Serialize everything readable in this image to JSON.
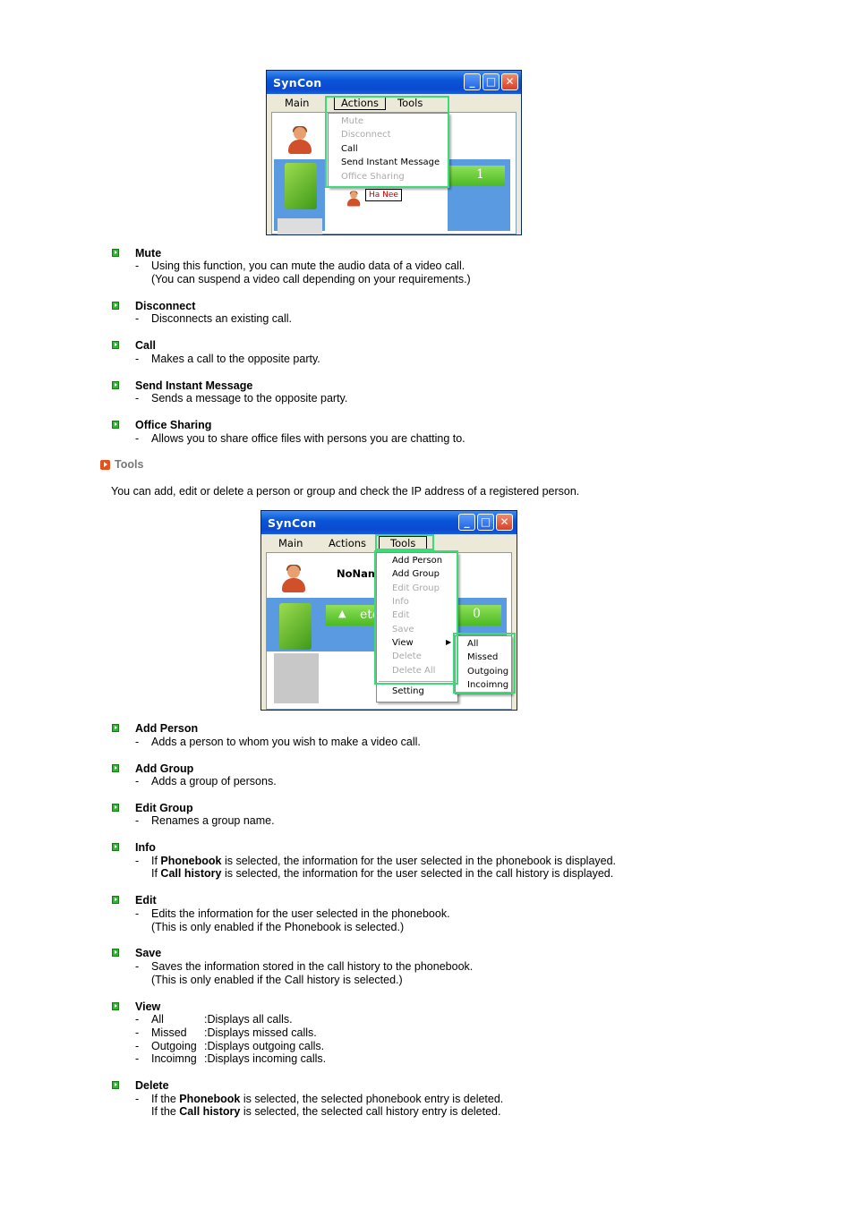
{
  "window1": {
    "title": "SynCon",
    "menu": [
      "Main",
      "Actions",
      "Tools"
    ],
    "actions_menu": [
      {
        "label": "Mute",
        "enabled": false
      },
      {
        "label": "Disconnect",
        "enabled": false
      },
      {
        "label": "Call",
        "enabled": true
      },
      {
        "label": "Send Instant Message",
        "enabled": true
      },
      {
        "label": "Office Sharing",
        "enabled": false
      }
    ],
    "count": "1",
    "contact": "Ha Nee"
  },
  "section1_items": [
    {
      "title": "Mute",
      "lines": [
        "Using this function, you can mute the audio data of a video call.",
        "(You can suspend a video call depending on your requirements.)"
      ]
    },
    {
      "title": "Disconnect",
      "lines": [
        "Disconnects an existing call."
      ]
    },
    {
      "title": "Call",
      "lines": [
        "Makes a call to the opposite party."
      ]
    },
    {
      "title": "Send Instant Message",
      "lines": [
        "Sends a message to the opposite party."
      ]
    },
    {
      "title": "Office Sharing",
      "lines": [
        "Allows you to share office files with persons you are chatting to."
      ]
    }
  ],
  "tools_heading": "Tools",
  "tools_intro": "You can add, edit or delete a person or group and check the IP address of a registered person.",
  "window2": {
    "title": "SynCon",
    "menu": [
      "Main",
      "Actions",
      "Tools"
    ],
    "user": "NoNam",
    "group_label": "etc",
    "count": "0",
    "tools_menu": [
      {
        "label": "Add Person",
        "enabled": true
      },
      {
        "label": "Add Group",
        "enabled": true
      },
      {
        "label": "Edit Group",
        "enabled": false
      },
      {
        "label": "Info",
        "enabled": false
      },
      {
        "label": "Edit",
        "enabled": false
      },
      {
        "label": "Save",
        "enabled": false
      },
      {
        "label": "View",
        "enabled": true
      },
      {
        "label": "Delete",
        "enabled": false
      },
      {
        "label": "Delete All",
        "enabled": false
      },
      {
        "label": "Setting",
        "enabled": true
      }
    ],
    "view_submenu": [
      "All",
      "Missed",
      "Outgoing",
      "Incoimng"
    ]
  },
  "section2": {
    "add_person": {
      "title": "Add Person",
      "line": "Adds a person to whom you wish to make a video call."
    },
    "add_group": {
      "title": "Add Group",
      "line": "Adds a group of persons."
    },
    "edit_group": {
      "title": "Edit Group",
      "line": "Renames a group name."
    },
    "info": {
      "title": "Info",
      "line1_pre": "If ",
      "line1_bold": "Phonebook",
      "line1_post": " is selected, the information for the user selected in the phonebook is displayed.",
      "line2_pre": "If ",
      "line2_bold": "Call history",
      "line2_post": " is selected, the information for the user selected in the call history is displayed."
    },
    "edit": {
      "title": "Edit",
      "line1": "Edits the information for the user selected in the phonebook.",
      "line2": "(This is only enabled if the Phonebook is selected.)"
    },
    "save": {
      "title": "Save",
      "line1": "Saves the information stored in the call history to the phonebook.",
      "line2": "(This is only enabled if the Call history is selected.)"
    },
    "view": {
      "title": "View",
      "rows": [
        {
          "key": "All",
          "desc": ":Displays all calls."
        },
        {
          "key": "Missed",
          "desc": ":Displays missed calls."
        },
        {
          "key": "Outgoing",
          "desc": ":Displays outgoing calls."
        },
        {
          "key": "Incoimng",
          "desc": ":Displays incoming calls."
        }
      ]
    },
    "delete": {
      "title": "Delete",
      "line1_pre": "If the ",
      "line1_bold": "Phonebook",
      "line1_post": " is selected, the selected phonebook entry is deleted.",
      "line2_pre": "If the ",
      "line2_bold": "Call history",
      "line2_post": " is selected, the selected call history entry is deleted."
    }
  },
  "colors": {
    "highlight": "#3adc78",
    "bullet": "#2db82d",
    "heading_orange": "#e8501a",
    "titlebar": "#0a55d8"
  }
}
